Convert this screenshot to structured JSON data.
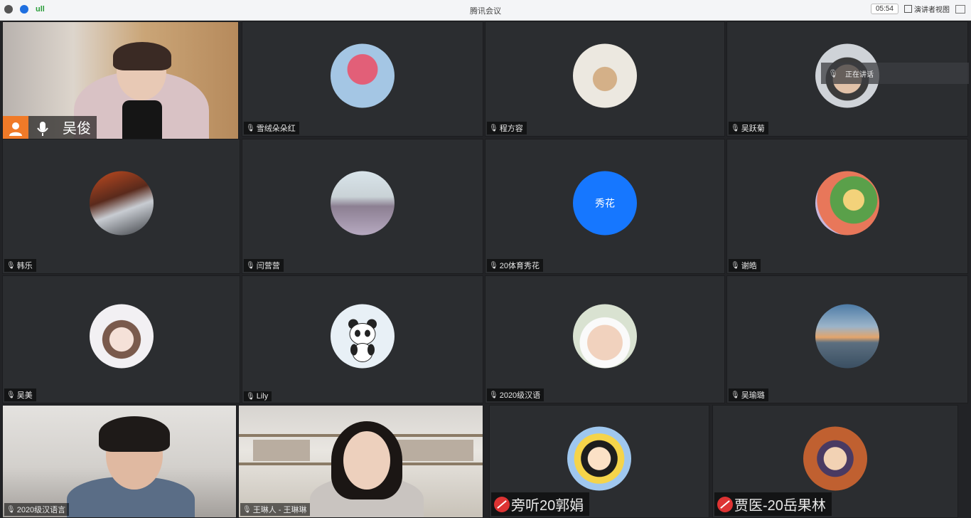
{
  "window": {
    "title": "腾讯会议",
    "signal": "ull",
    "timer": "05:54",
    "gallery_label": "演讲者视图"
  },
  "speaker_tile": {
    "name": "吴俊"
  },
  "popup": {
    "text": "正在讲话",
    "extra": ""
  },
  "tiles": [
    {
      "name": "雪绒朵朵红"
    },
    {
      "name": "程方容"
    },
    {
      "name": "吴跃菊"
    },
    {
      "name": "韩乐"
    },
    {
      "name": "闫营营"
    },
    {
      "name": "20体育秀花",
      "avatar_text": "秀花"
    },
    {
      "name": "谢皓"
    },
    {
      "name": "吴美"
    },
    {
      "name": "Lily"
    },
    {
      "name": "2020级汉语"
    },
    {
      "name": "吴瑜璐"
    }
  ],
  "bottom_tiles": [
    {
      "name": "2020级汉语言"
    },
    {
      "name": "王琳人 - 王琳琳"
    },
    {
      "name": "旁听20郭娟"
    },
    {
      "name": "贾医-20岳果林"
    }
  ],
  "colors": {
    "accent_blue": "#1677ff",
    "mic_off_red": "#d33333",
    "speaker_orange": "#f07a28"
  }
}
